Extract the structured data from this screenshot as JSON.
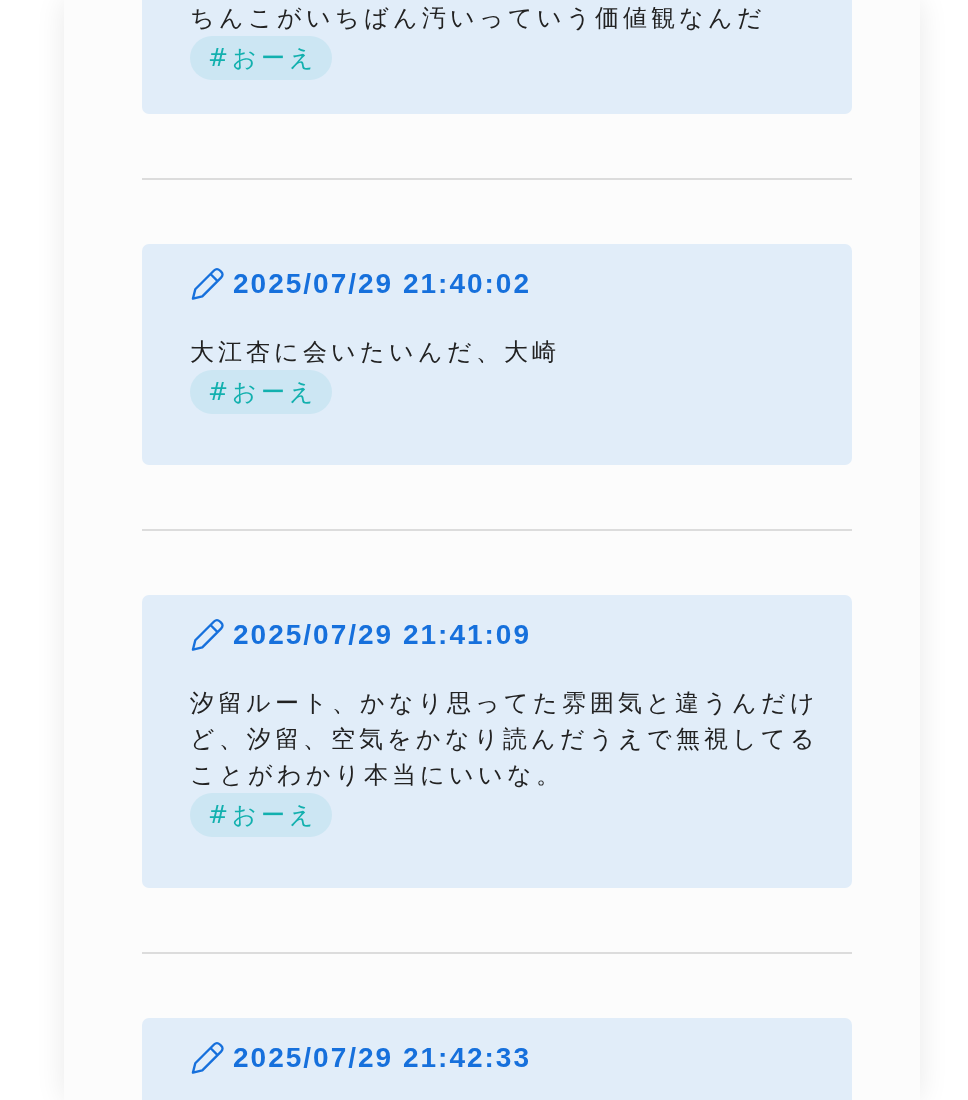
{
  "posts": [
    {
      "text": "ちんこがいちばん汚いっていう価値観なんだ",
      "tags": [
        "#おーえ"
      ]
    },
    {
      "timestamp": "2025/07/29 21:40:02",
      "text": "大江杏に会いたいんだ、大崎",
      "tags": [
        "#おーえ"
      ]
    },
    {
      "timestamp": "2025/07/29 21:41:09",
      "text": "汐留ルート、かなり思ってた雰囲気と違うんだけど、汐留、空気をかなり読んだうえで無視してることがわかり本当にいいな。",
      "tags": [
        "#おーえ"
      ]
    },
    {
      "timestamp": "2025/07/29 21:42:33"
    }
  ]
}
